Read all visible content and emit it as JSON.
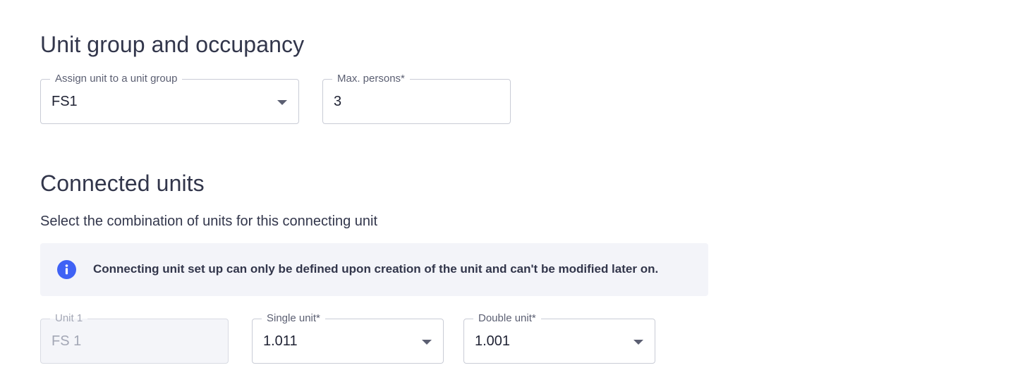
{
  "occupancy": {
    "title": "Unit group and occupancy",
    "unit_group": {
      "label": "Assign unit to a unit group",
      "value": "FS1",
      "icon": "chevron-down-icon"
    },
    "max_persons": {
      "label": "Max. persons*",
      "value": "3"
    }
  },
  "connected": {
    "title": "Connected units",
    "description": "Select the combination of units for this connecting unit",
    "info": {
      "icon": "info-icon",
      "text": "Connecting unit set up can only be defined upon creation of the unit and can't be modified later on."
    },
    "unit1": {
      "label": "Unit 1",
      "value": "FS 1"
    },
    "single_unit": {
      "label": "Single unit*",
      "value": "1.011",
      "icon": "chevron-down-icon"
    },
    "double_unit": {
      "label": "Double unit*",
      "value": "1.001",
      "icon": "chevron-down-icon"
    }
  },
  "colors": {
    "accent": "#3f62f5",
    "text": "#32364b",
    "border": "#c9ccd6",
    "info_background": "#f3f4f9",
    "disabled_text": "#a3a7b5"
  }
}
